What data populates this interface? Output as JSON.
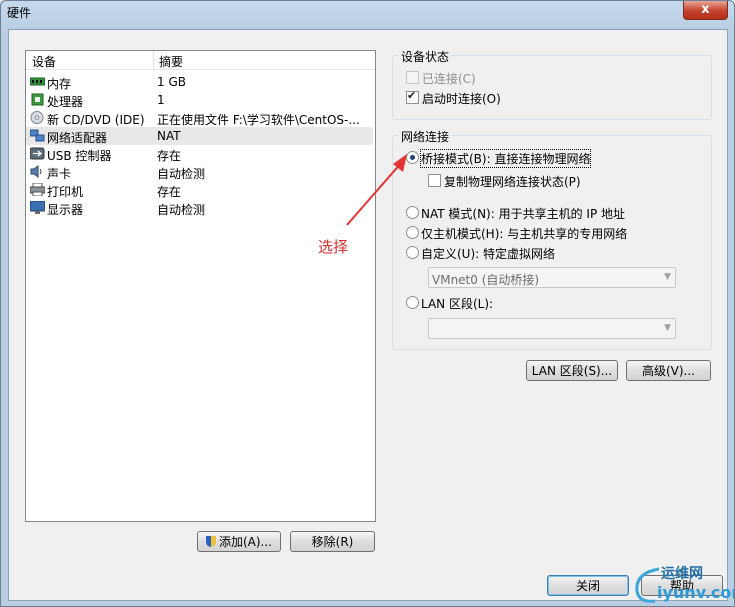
{
  "window": {
    "title": "硬件",
    "close_glyph": "x"
  },
  "devices": {
    "headers": [
      "设备",
      "摘要"
    ],
    "rows": [
      {
        "icon": "memory-icon",
        "name": "内存",
        "summary": "1 GB",
        "selected": false
      },
      {
        "icon": "processor-icon",
        "name": "处理器",
        "summary": "1",
        "selected": false
      },
      {
        "icon": "cd-dvd-icon",
        "name": "新 CD/DVD (IDE)",
        "summary": "正在使用文件 F:\\学习软件\\CentOS-...",
        "selected": false
      },
      {
        "icon": "network-adapter-icon",
        "name": "网络适配器",
        "summary": "NAT",
        "selected": true
      },
      {
        "icon": "usb-icon",
        "name": "USB 控制器",
        "summary": "存在",
        "selected": false
      },
      {
        "icon": "sound-icon",
        "name": "声卡",
        "summary": "自动检测",
        "selected": false
      },
      {
        "icon": "printer-icon",
        "name": "打印机",
        "summary": "存在",
        "selected": false
      },
      {
        "icon": "display-icon",
        "name": "显示器",
        "summary": "自动检测",
        "selected": false
      }
    ],
    "add_label": "添加(A)...",
    "remove_label": "移除(R)"
  },
  "device_status": {
    "title": "设备状态",
    "connected_label": "已连接(C)",
    "connected_checked": false,
    "connect_on_power_label": "启动时连接(O)",
    "connect_on_power_checked": true
  },
  "network": {
    "title": "网络连接",
    "bridged_label": "桥接模式(B): 直接连接物理网络",
    "replicate_label": "复制物理网络连接状态(P)",
    "nat_label": "NAT 模式(N): 用于共享主机的 IP 地址",
    "host_only_label": "仅主机模式(H): 与主机共享的专用网络",
    "custom_label": "自定义(U): 特定虚拟网络",
    "custom_select_value": "VMnet0 (自动桥接)",
    "lan_label": "LAN 区段(L):",
    "lan_select_value": "",
    "selected": "bridged"
  },
  "buttons": {
    "lan_segments": "LAN 区段(S)...",
    "advanced": "高级(V)...",
    "close": "关闭",
    "help": "帮助"
  },
  "annotation": {
    "text": "选择",
    "color": "#d62f2f"
  },
  "watermark": {
    "cn": "运维网",
    "en": "iyunv.com"
  }
}
